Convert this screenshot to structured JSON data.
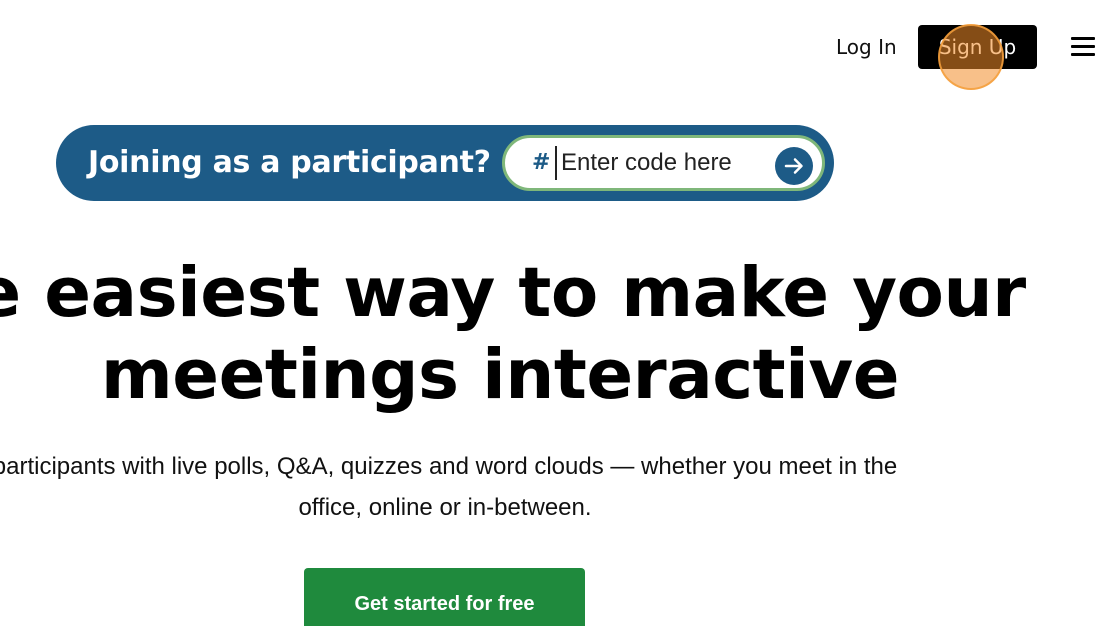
{
  "header": {
    "login_label": "Log In",
    "signup_label": "Sign Up",
    "menu_icon": "hamburger-menu-icon"
  },
  "join": {
    "title": "Joining as a participant?",
    "hash_symbol": "#",
    "code_placeholder": "Enter code here",
    "code_value": "",
    "submit_icon": "arrow-right-icon"
  },
  "hero": {
    "headline_line1": "e easiest way to make your",
    "headline_line2": "meetings interactive",
    "subtitle_line1": "participants with live polls, Q&A, quizzes and word clouds — whether you meet in the",
    "subtitle_line2": "office, online or in-between.",
    "cta_label": "Get started for free"
  },
  "colors": {
    "join_bar": "#1d5b87",
    "code_box_border": "#7fb77a",
    "cta": "#1f8a3d",
    "signup_bg": "#000000",
    "click_indicator": "#f28c28"
  }
}
